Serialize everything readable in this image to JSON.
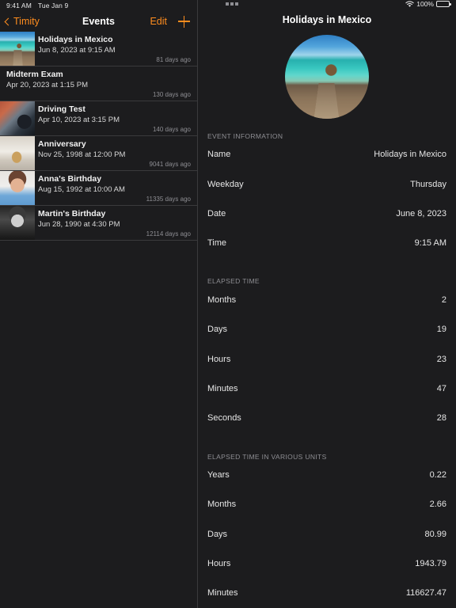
{
  "left": {
    "status_bar": {
      "time": "9:41 AM",
      "date": "Tue Jan 9"
    },
    "nav": {
      "back_label": "Timity",
      "title": "Events",
      "edit_label": "Edit",
      "add_label": "+"
    },
    "events": [
      {
        "title": "Holidays in Mexico",
        "subtitle": "Jun 8, 2023 at 9:15 AM",
        "ago": "81 days ago",
        "thumb": "beach-photo"
      },
      {
        "title": "Midterm Exam",
        "subtitle": "Apr 20, 2023 at 1:15 PM",
        "ago": "130 days ago",
        "thumb": "none"
      },
      {
        "title": "Driving Test",
        "subtitle": "Apr 10, 2023 at 3:15 PM",
        "ago": "140 days ago",
        "thumb": "car-photo"
      },
      {
        "title": "Anniversary",
        "subtitle": "Nov 25, 1998 at 12:00 PM",
        "ago": "9041 days ago",
        "thumb": "food-photo"
      },
      {
        "title": "Anna's Birthday",
        "subtitle": "Aug 15, 1992 at 10:00 AM",
        "ago": "11335 days ago",
        "thumb": "girl-photo"
      },
      {
        "title": "Martin's Birthday",
        "subtitle": "Jun 28, 1990 at 4:30 PM",
        "ago": "12114 days ago",
        "thumb": "man-photo"
      }
    ]
  },
  "right": {
    "status_bar": {
      "battery_percent": "100%"
    },
    "title": "Holidays in Mexico",
    "hero_image": "beach-photo-circular",
    "sections": [
      {
        "header": "EVENT INFORMATION",
        "rows": [
          {
            "label": "Name",
            "value": "Holidays in Mexico"
          },
          {
            "label": "Weekday",
            "value": "Thursday"
          },
          {
            "label": "Date",
            "value": "June 8, 2023"
          },
          {
            "label": "Time",
            "value": "9:15 AM"
          }
        ]
      },
      {
        "header": "ELAPSED TIME",
        "rows": [
          {
            "label": "Months",
            "value": "2"
          },
          {
            "label": "Days",
            "value": "19"
          },
          {
            "label": "Hours",
            "value": "23"
          },
          {
            "label": "Minutes",
            "value": "47"
          },
          {
            "label": "Seconds",
            "value": "28"
          }
        ]
      },
      {
        "header": "ELAPSED TIME IN VARIOUS UNITS",
        "rows": [
          {
            "label": "Years",
            "value": "0.22"
          },
          {
            "label": "Months",
            "value": "2.66"
          },
          {
            "label": "Days",
            "value": "80.99"
          },
          {
            "label": "Hours",
            "value": "1943.79"
          },
          {
            "label": "Minutes",
            "value": "116627.47"
          }
        ]
      }
    ]
  },
  "colors": {
    "accent": "#ff8d1e",
    "background": "#1c1c1e",
    "separator": "#3a3a3c",
    "secondary_text": "#8e8e93"
  }
}
